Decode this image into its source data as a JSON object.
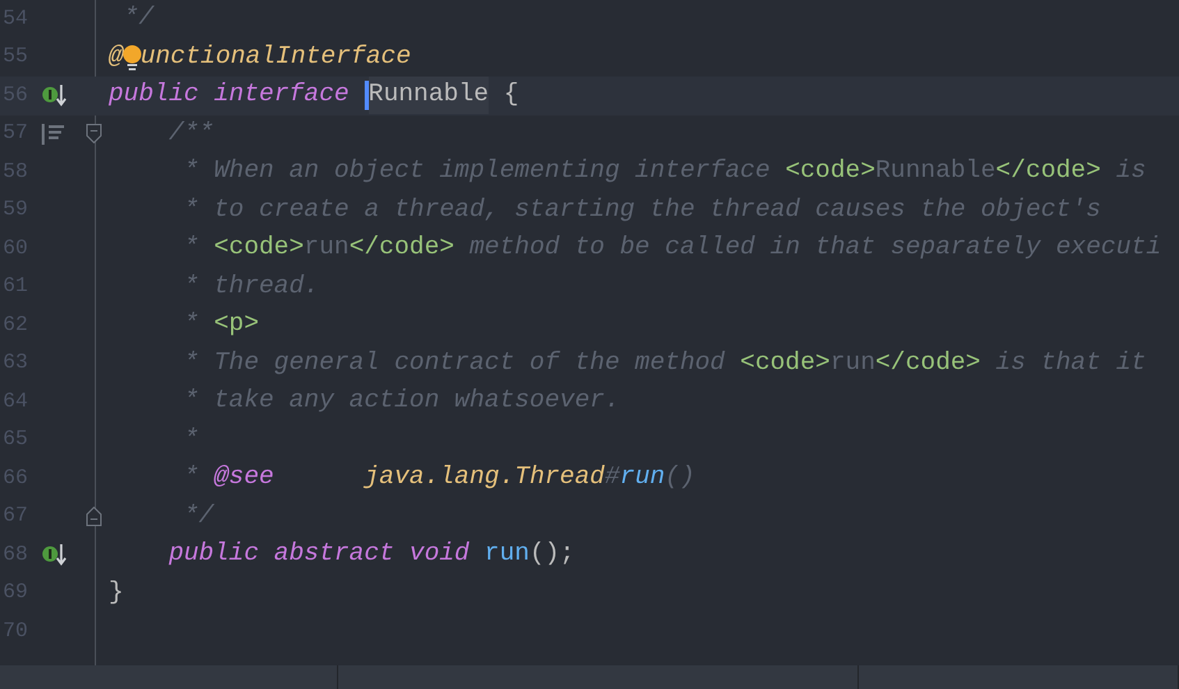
{
  "editor": {
    "lines": [
      {
        "number": "54",
        "current": false,
        "implemented": false,
        "doc_toggle": false,
        "fold_start": false,
        "fold_end": false,
        "tokens": [
          {
            "kind": "comment",
            "text": " */"
          }
        ]
      },
      {
        "number": "55",
        "current": false,
        "implemented": false,
        "doc_toggle": false,
        "fold_start": false,
        "fold_end": false,
        "tokens": [
          {
            "kind": "annotation",
            "text": "@"
          },
          {
            "kind": "bulb"
          },
          {
            "kind": "annotation",
            "text": "unctionalInterface"
          }
        ]
      },
      {
        "number": "56",
        "current": true,
        "implemented": true,
        "doc_toggle": false,
        "fold_start": false,
        "fold_end": false,
        "tokens": [
          {
            "kind": "keyword",
            "text": "public interface "
          },
          {
            "kind": "caret"
          },
          {
            "kind": "declaration",
            "text": "Runnable"
          },
          {
            "kind": "plain",
            "text": " {"
          }
        ],
        "children": [
          {
            "number": "57",
            "current": false,
            "implemented": false,
            "doc_toggle": true,
            "fold_start": true,
            "fold_end": false,
            "tokens": [
              {
                "kind": "comment",
                "text": "/**"
              }
            ]
          },
          {
            "number": "58",
            "current": false,
            "implemented": false,
            "doc_toggle": false,
            "fold_start": false,
            "fold_end": false,
            "tokens": [
              {
                "kind": "comment",
                "text": " * When an object implementing interface "
              },
              {
                "kind": "tag",
                "text": "<code>"
              },
              {
                "kind": "doc-code",
                "text": "Runnable"
              },
              {
                "kind": "tag",
                "text": "</code>"
              },
              {
                "kind": "comment",
                "text": " is"
              }
            ]
          },
          {
            "number": "59",
            "current": false,
            "implemented": false,
            "doc_toggle": false,
            "fold_start": false,
            "fold_end": false,
            "tokens": [
              {
                "kind": "comment",
                "text": " * to create a thread, starting the thread causes the object's"
              }
            ]
          },
          {
            "number": "60",
            "current": false,
            "implemented": false,
            "doc_toggle": false,
            "fold_start": false,
            "fold_end": false,
            "tokens": [
              {
                "kind": "comment",
                "text": " * "
              },
              {
                "kind": "tag",
                "text": "<code>"
              },
              {
                "kind": "doc-code",
                "text": "run"
              },
              {
                "kind": "tag",
                "text": "</code>"
              },
              {
                "kind": "comment",
                "text": " method to be called in that separately executi"
              }
            ]
          },
          {
            "number": "61",
            "current": false,
            "implemented": false,
            "doc_toggle": false,
            "fold_start": false,
            "fold_end": false,
            "tokens": [
              {
                "kind": "comment",
                "text": " * thread."
              }
            ]
          },
          {
            "number": "62",
            "current": false,
            "implemented": false,
            "doc_toggle": false,
            "fold_start": false,
            "fold_end": false,
            "tokens": [
              {
                "kind": "comment",
                "text": " * "
              },
              {
                "kind": "tag",
                "text": "<p>"
              }
            ]
          },
          {
            "number": "63",
            "current": false,
            "implemented": false,
            "doc_toggle": false,
            "fold_start": false,
            "fold_end": false,
            "tokens": [
              {
                "kind": "comment",
                "text": " * The general contract of the method "
              },
              {
                "kind": "tag",
                "text": "<code>"
              },
              {
                "kind": "doc-code",
                "text": "run"
              },
              {
                "kind": "tag",
                "text": "</code>"
              },
              {
                "kind": "comment",
                "text": " is that it"
              }
            ]
          },
          {
            "number": "64",
            "current": false,
            "implemented": false,
            "doc_toggle": false,
            "fold_start": false,
            "fold_end": false,
            "tokens": [
              {
                "kind": "comment",
                "text": " * take any action whatsoever."
              }
            ]
          },
          {
            "number": "65",
            "current": false,
            "implemented": false,
            "doc_toggle": false,
            "fold_start": false,
            "fold_end": false,
            "tokens": [
              {
                "kind": "comment",
                "text": " *"
              }
            ]
          },
          {
            "number": "66",
            "current": false,
            "implemented": false,
            "doc_toggle": false,
            "fold_start": false,
            "fold_end": false,
            "tokens": [
              {
                "kind": "comment",
                "text": " * "
              },
              {
                "kind": "doc-keyword",
                "text": "@see"
              },
              {
                "kind": "type-ref",
                "text": "      java.lang.Thread"
              },
              {
                "kind": "comment",
                "text": "#"
              },
              {
                "kind": "method-ref",
                "text": "run"
              },
              {
                "kind": "comment",
                "text": "()"
              }
            ]
          },
          {
            "number": "67",
            "current": false,
            "implemented": false,
            "doc_toggle": false,
            "fold_start": false,
            "fold_end": true,
            "tokens": [
              {
                "kind": "comment",
                "text": " */"
              }
            ]
          },
          {
            "number": "68",
            "current": false,
            "implemented": true,
            "doc_toggle": false,
            "fold_start": false,
            "fold_end": false,
            "tokens": [
              {
                "kind": "keyword",
                "text": "public abstract void "
              },
              {
                "kind": "method",
                "text": "run"
              },
              {
                "kind": "plain",
                "text": "();"
              }
            ]
          }
        ]
      },
      {
        "number": "69",
        "current": false,
        "implemented": false,
        "doc_toggle": false,
        "fold_start": false,
        "fold_end": false,
        "tokens": [
          {
            "kind": "plain",
            "text": "}"
          }
        ]
      },
      {
        "number": "70",
        "current": false,
        "implemented": false,
        "doc_toggle": false,
        "fold_start": false,
        "fold_end": false
      }
    ]
  }
}
